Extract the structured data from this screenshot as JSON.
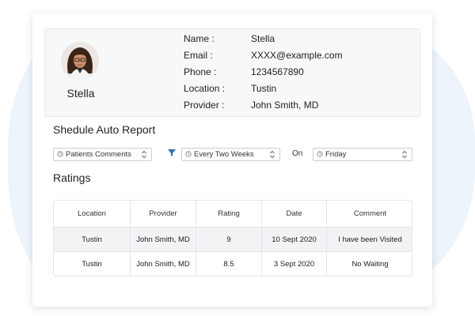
{
  "profile": {
    "name": "Stella",
    "fields": [
      {
        "label": "Name :",
        "value": "Stella"
      },
      {
        "label": "Email :",
        "value": "XXXX@example.com"
      },
      {
        "label": "Phone :",
        "value": "1234567890"
      },
      {
        "label": "Location :",
        "value": "Tustin"
      },
      {
        "label": "Provider :",
        "value": "John Smith, MD"
      }
    ]
  },
  "schedule": {
    "title": "Shedule Auto Report",
    "report_type": "Patients Comments",
    "frequency": "Every Two Weeks",
    "on_label": "On",
    "day": "Friday"
  },
  "ratings": {
    "title": "Ratings",
    "columns": [
      "Location",
      "Provider",
      "Rating",
      "Date",
      "Comment"
    ],
    "rows": [
      [
        "Tustin",
        "John Smith, MD",
        "9",
        "10 Sept 2020",
        "I have been Visited"
      ],
      [
        "Tustin",
        "John Smith, MD",
        "8.5",
        "3 Sept 2020",
        "No Waiting"
      ]
    ]
  },
  "colors": {
    "accent": "#2f6fb0",
    "background_blob": "#eef4fb"
  }
}
